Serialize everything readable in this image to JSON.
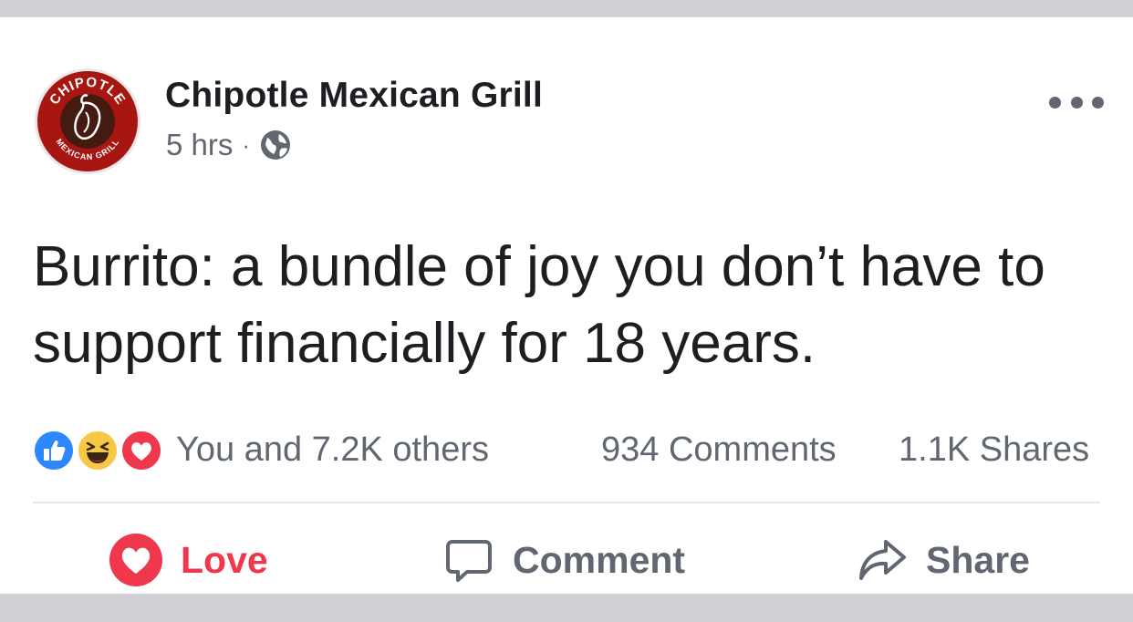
{
  "post": {
    "page_name": "Chipotle Mexican Grill",
    "time": "5 hrs",
    "separator": "·",
    "privacy_icon": "globe-icon",
    "text": "Burrito: a bundle of joy you don’t have to support financially for 18 years.",
    "avatar": {
      "logo_top_text": "CHIPOTLE",
      "logo_bottom_text": "MEXICAN GRILL",
      "brand_color": "#a81612"
    }
  },
  "stats": {
    "reactions": [
      "like",
      "haha",
      "love"
    ],
    "reactions_text": "You and 7.2K others",
    "comments": "934 Comments",
    "shares": "1.1K Shares"
  },
  "actions": {
    "love_label": "Love",
    "comment_label": "Comment",
    "share_label": "Share"
  },
  "colors": {
    "love": "#f0384d",
    "like": "#2d88ff",
    "haha": "#f7c845",
    "text_secondary": "#606770",
    "text_primary": "#1c1e21"
  }
}
